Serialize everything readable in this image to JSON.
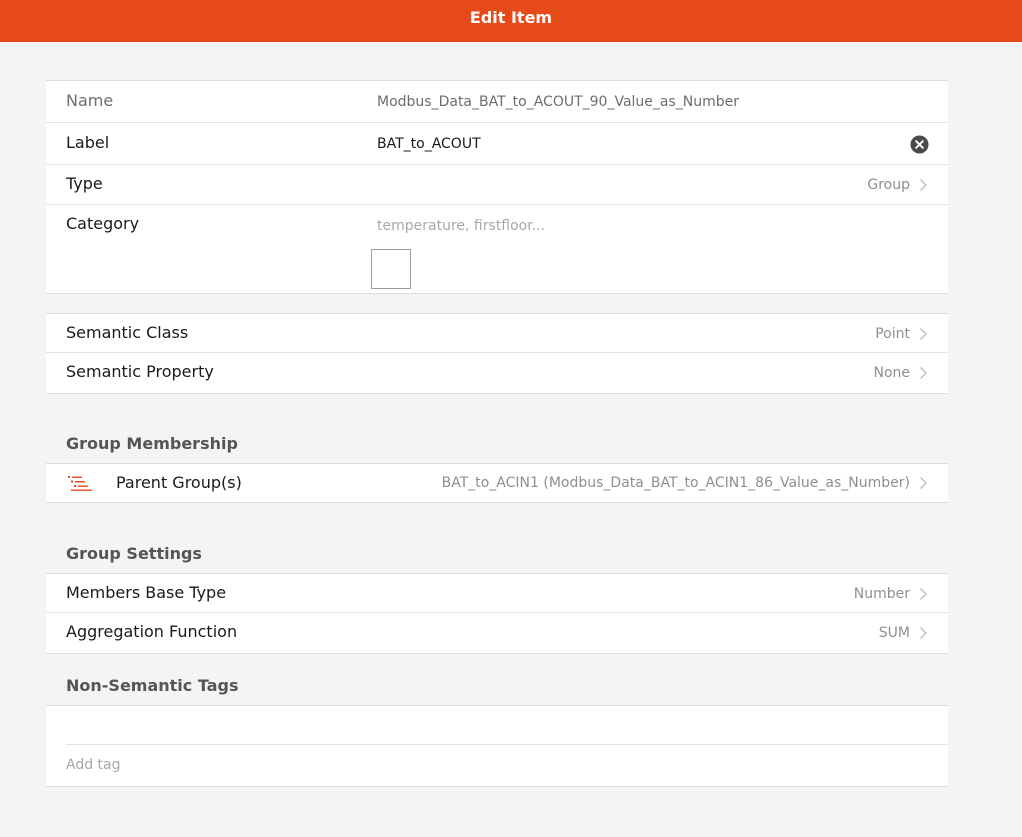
{
  "navbar": {
    "title": "Edit Item",
    "color": "#e64a19"
  },
  "item": {
    "name_label": "Name",
    "name_value": "Modbus_Data_BAT_to_ACOUT_90_Value_as_Number",
    "label_label": "Label",
    "label_value": "BAT_to_ACOUT",
    "type_label": "Type",
    "type_value": "Group",
    "category_label": "Category",
    "category_placeholder": "temperature, firstfloor..."
  },
  "semantics": {
    "class_label": "Semantic Class",
    "class_value": "Point",
    "property_label": "Semantic Property",
    "property_value": "None"
  },
  "group_membership": {
    "title": "Group Membership",
    "icon": "list-icon",
    "parent_label": "Parent Group(s)",
    "parent_value": "BAT_to_ACIN1 (Modbus_Data_BAT_to_ACIN1_86_Value_as_Number)"
  },
  "group_settings": {
    "title": "Group Settings",
    "base_type_label": "Members Base Type",
    "base_type_value": "Number",
    "aggregation_label": "Aggregation Function",
    "aggregation_value": "SUM"
  },
  "tags": {
    "title": "Non-Semantic Tags",
    "add_placeholder": "Add tag"
  }
}
